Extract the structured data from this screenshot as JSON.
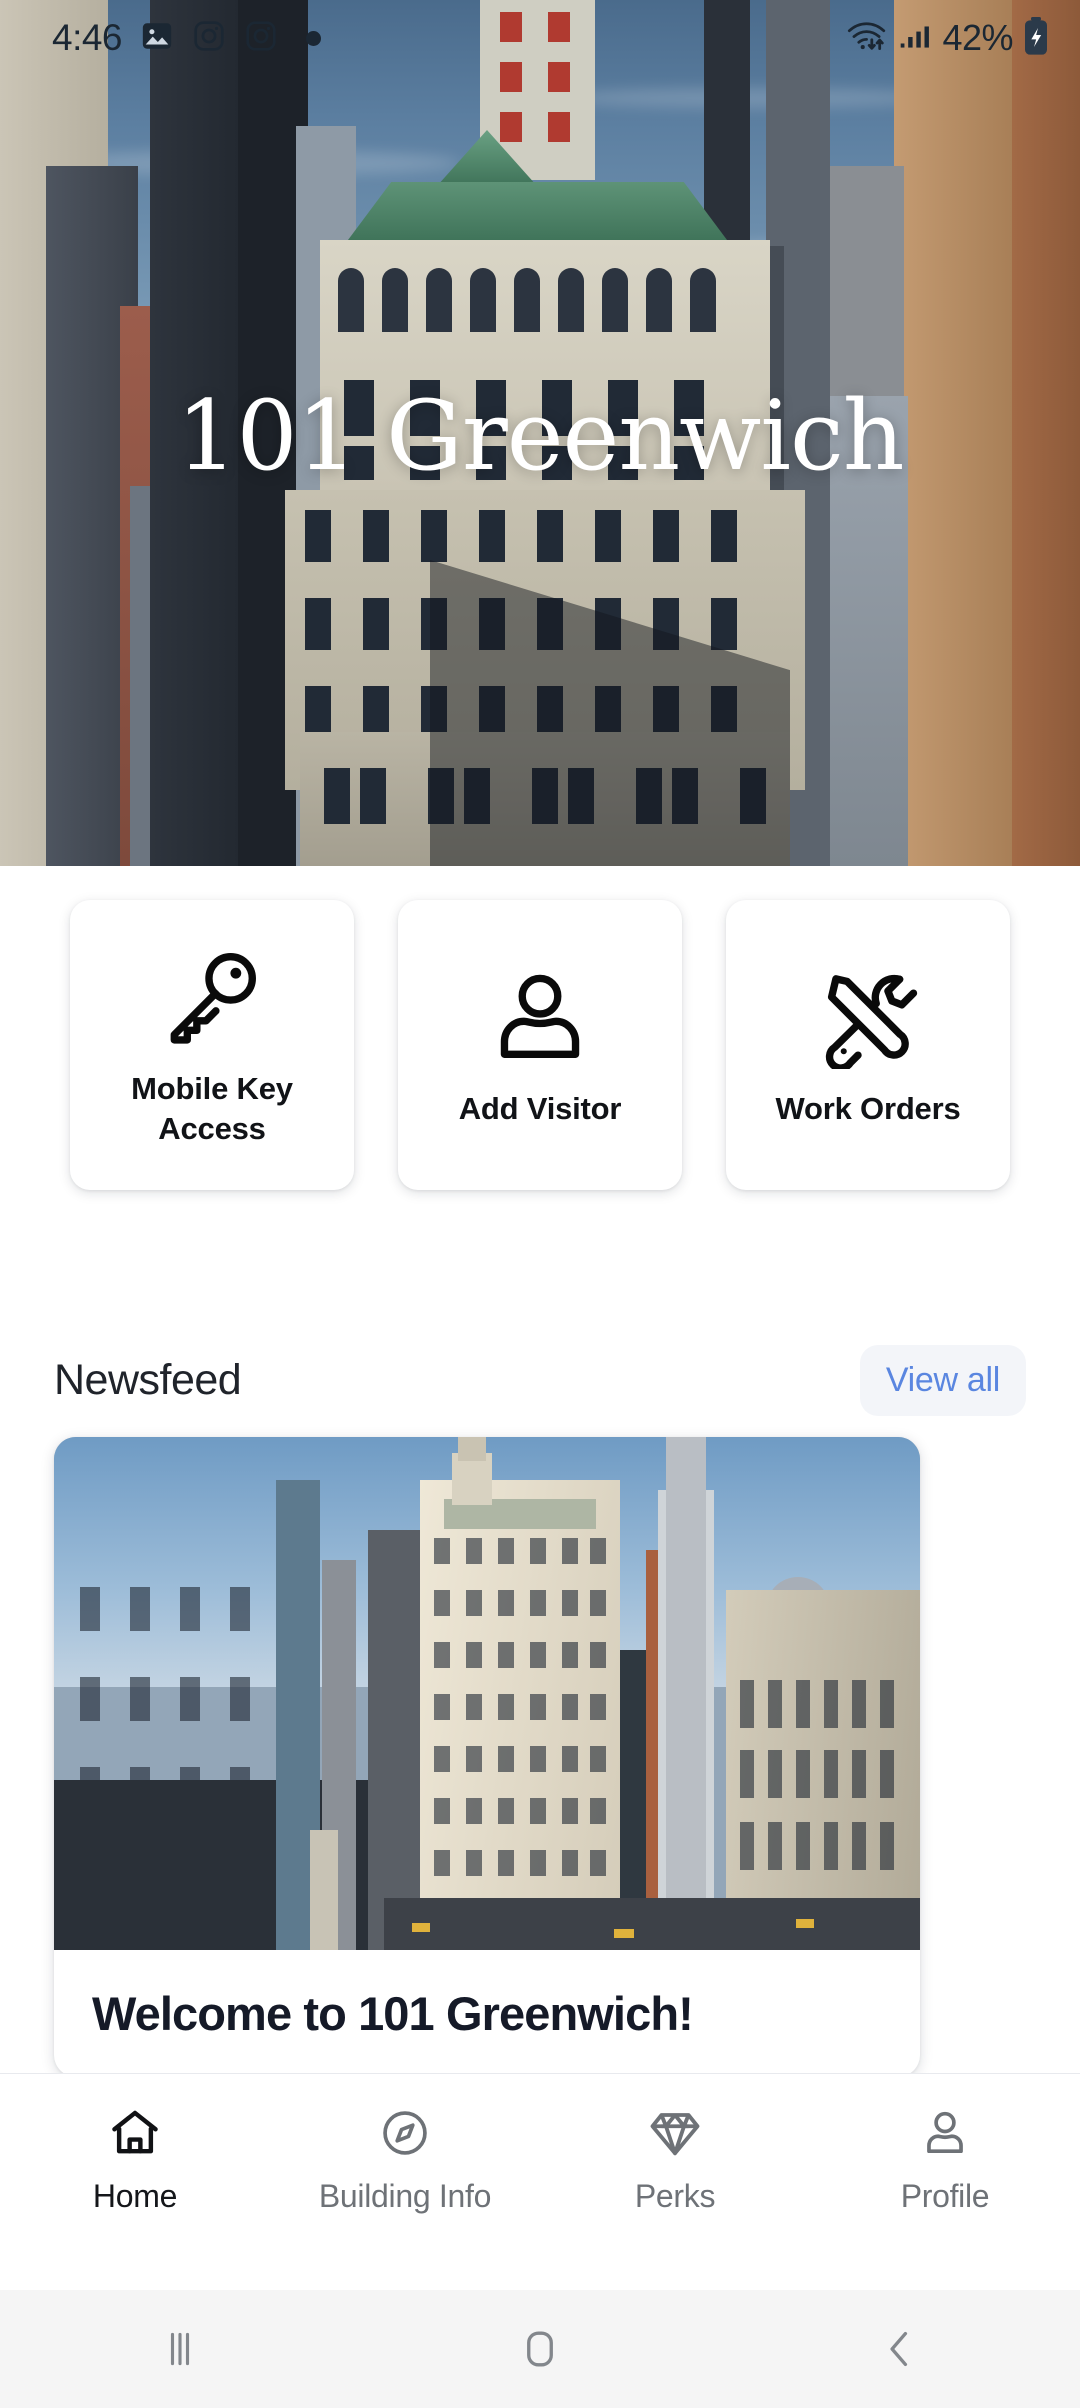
{
  "status_bar": {
    "time": "4:46",
    "battery_percent": "42%",
    "icons": [
      "gallery-icon",
      "instagram-icon",
      "instagram-icon",
      "notification-dot",
      "wifi-icon",
      "cellular-signal-icon",
      "battery-charging-icon"
    ]
  },
  "hero": {
    "title": "101 Greenwich",
    "image_alt": "aerial-photo-of-101-greenwich-building"
  },
  "quick_actions": [
    {
      "label": "Mobile Key Access",
      "icon": "key-icon"
    },
    {
      "label": "Add Visitor",
      "icon": "person-icon"
    },
    {
      "label": "Work Orders",
      "icon": "tools-icon"
    }
  ],
  "newsfeed": {
    "heading": "Newsfeed",
    "view_all_label": "View all",
    "view_all_color": "#5a86e0",
    "cards": [
      {
        "title": "Welcome to 101 Greenwich!",
        "image_alt": "aerial-view-of-lower-manhattan-skyline"
      }
    ]
  },
  "bottom_nav": {
    "items": [
      {
        "label": "Home",
        "icon": "home-icon",
        "active": true
      },
      {
        "label": "Building Info",
        "icon": "compass-icon",
        "active": false
      },
      {
        "label": "Perks",
        "icon": "diamond-icon",
        "active": false
      },
      {
        "label": "Profile",
        "icon": "person-icon",
        "active": false
      }
    ]
  },
  "system_nav": {
    "recents_label": "Recents",
    "home_label": "Home",
    "back_label": "Back"
  }
}
